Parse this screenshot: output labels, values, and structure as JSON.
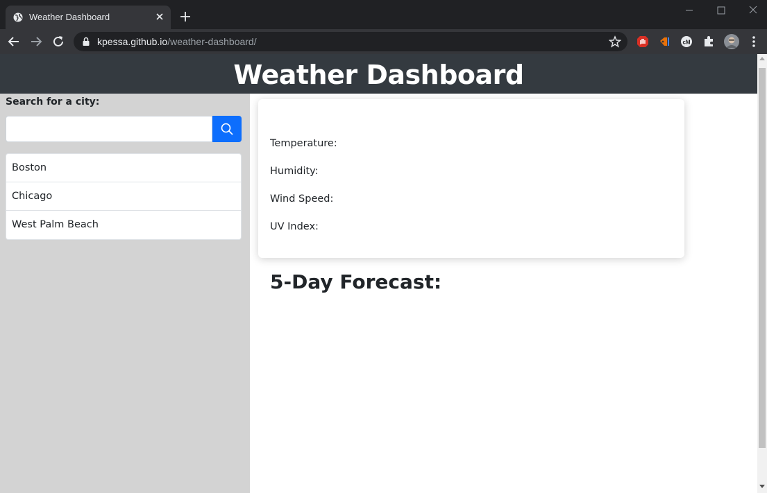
{
  "browser": {
    "tab_title": "Weather Dashboard",
    "url_host": "kpessa.github.io",
    "url_path": "/weather-dashboard/"
  },
  "header": {
    "title": "Weather Dashboard"
  },
  "sidebar": {
    "search_label": "Search for a city:",
    "search_value": "",
    "search_placeholder": "",
    "cities": [
      {
        "label": "Boston"
      },
      {
        "label": "Chicago"
      },
      {
        "label": "West Palm Beach"
      }
    ]
  },
  "current": {
    "city_title": "",
    "temperature_label": "Temperature:",
    "humidity_label": "Humidity:",
    "wind_label": "Wind Speed:",
    "uv_label": "UV Index:"
  },
  "forecast": {
    "title": "5-Day Forecast:"
  },
  "colors": {
    "header_bg": "#343a40",
    "sidebar_bg": "#d3d3d3",
    "search_button": "#0d6efd"
  }
}
